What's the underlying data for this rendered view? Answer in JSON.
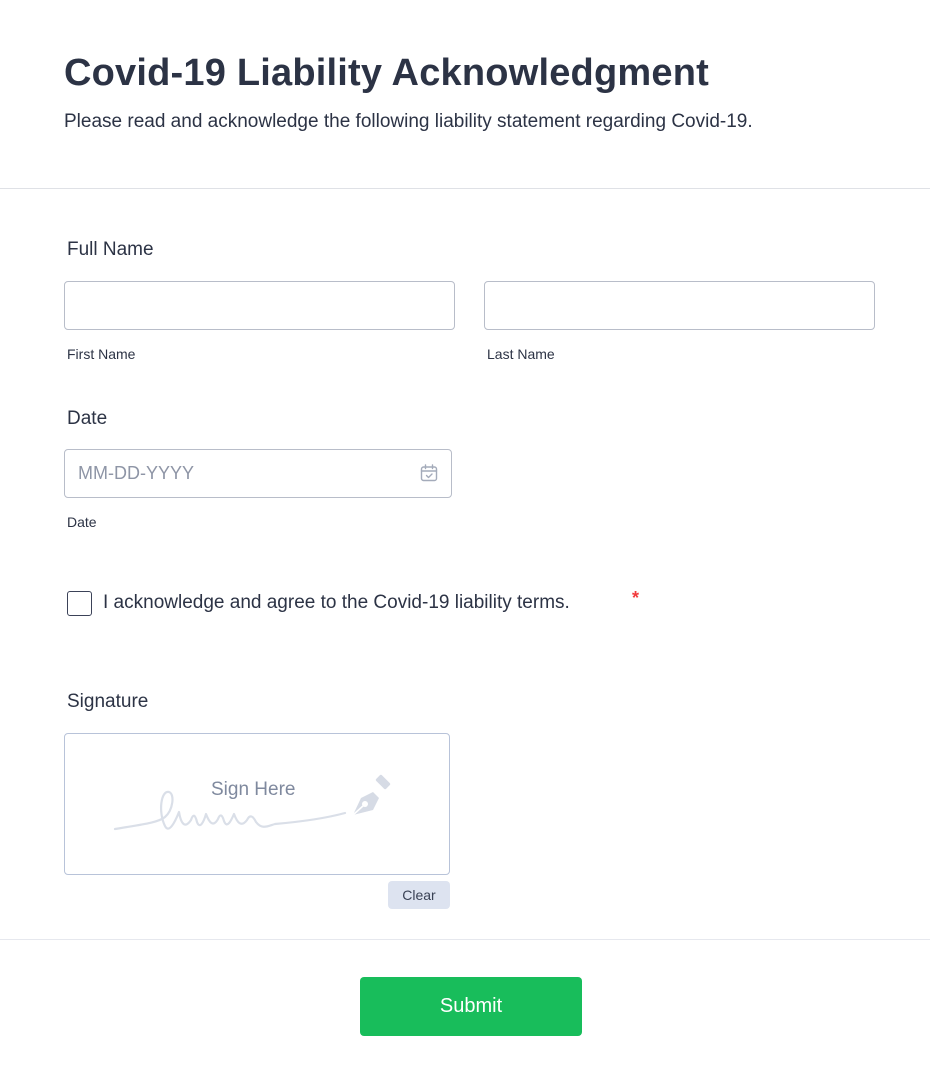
{
  "header": {
    "title": "Covid-19 Liability Acknowledgment",
    "subtitle": "Please read and acknowledge the following liability statement regarding Covid-19."
  },
  "full_name": {
    "label": "Full Name",
    "first": {
      "value": "",
      "sublabel": "First Name"
    },
    "last": {
      "value": "",
      "sublabel": "Last Name"
    }
  },
  "date": {
    "label": "Date",
    "placeholder": "MM-DD-YYYY",
    "value": "",
    "sublabel": "Date",
    "icon": "calendar-icon"
  },
  "acknowledge": {
    "label": "I acknowledge and agree to the Covid-19 liability terms.",
    "required_mark": "*",
    "checked": false
  },
  "signature": {
    "label": "Signature",
    "hint": "Sign Here",
    "clear_label": "Clear",
    "icon": "pen-nib-icon"
  },
  "submit": {
    "label": "Submit"
  },
  "colors": {
    "text": "#2c3345",
    "border": "#b8bdc9",
    "required": "#f23a3c",
    "submit_bg": "#18bd5b",
    "clear_bg": "#dde3f0"
  }
}
